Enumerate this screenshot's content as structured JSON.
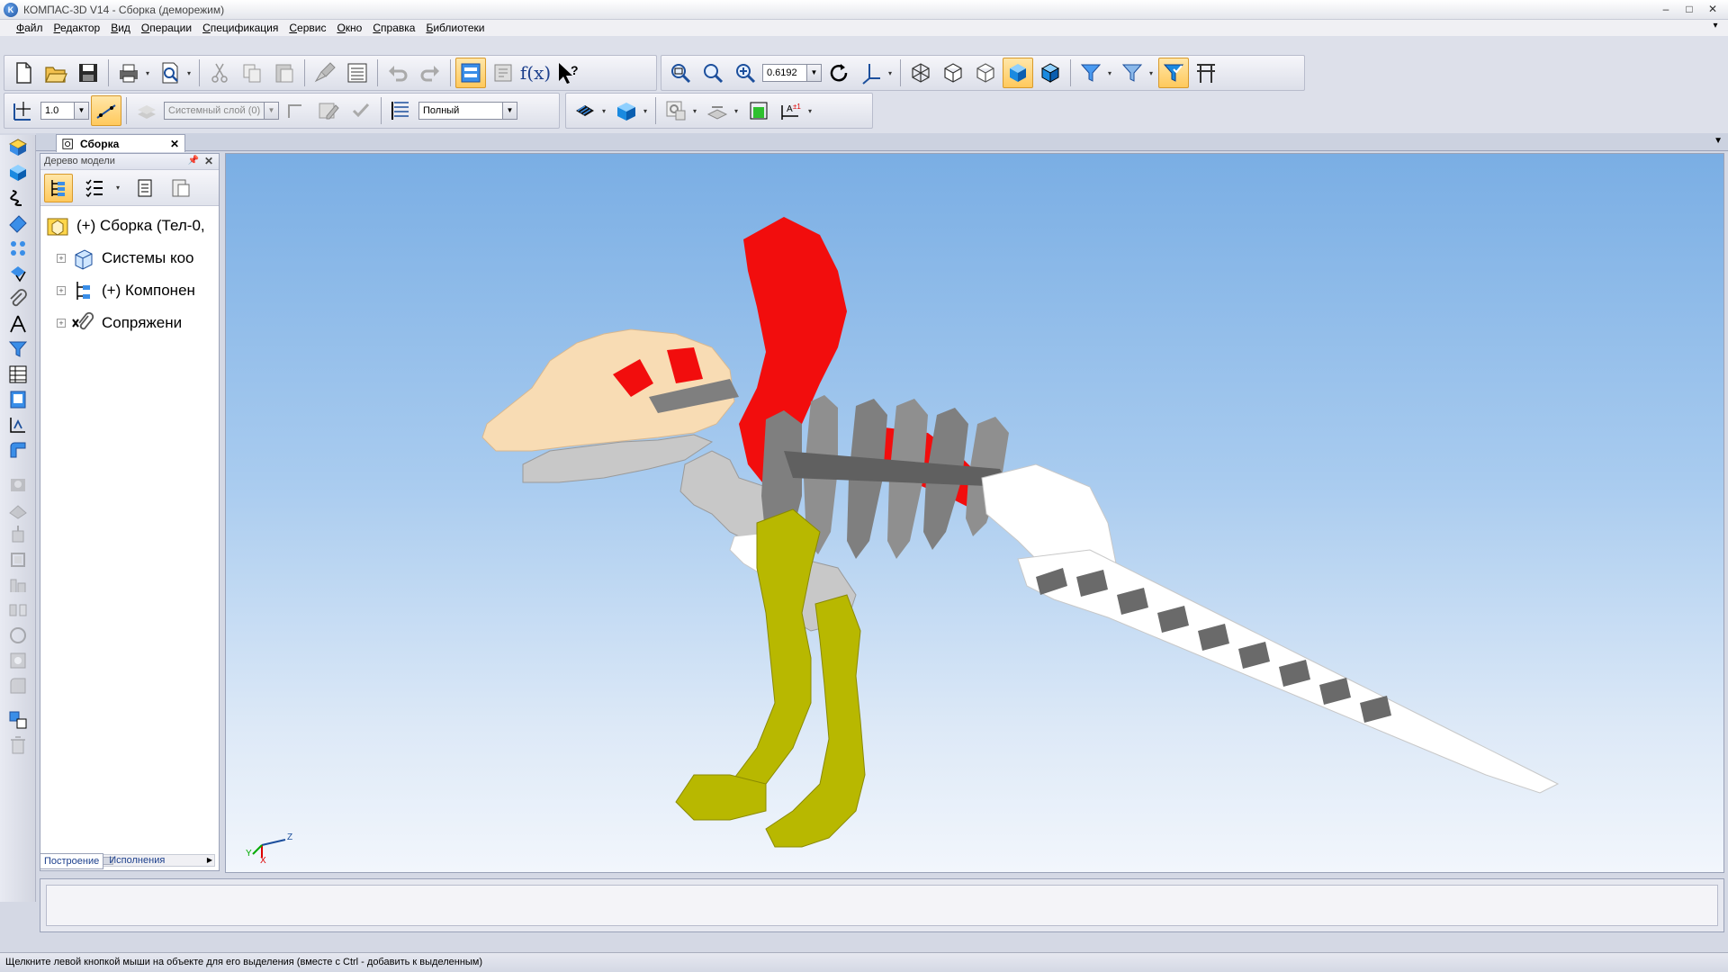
{
  "window": {
    "title": "КОМПАС-3D V14 - Сборка (деморежим)",
    "app_icon": "kompas-logo",
    "controls": [
      "–",
      "□",
      "✕"
    ]
  },
  "menu": [
    "Файл",
    "Редактор",
    "Вид",
    "Операции",
    "Спецификация",
    "Сервис",
    "Окно",
    "Справка",
    "Библиотеки"
  ],
  "toolbar": {
    "zoom_value": "0.6192",
    "step_value": "1.0",
    "layer_value": "Системный слой (0)",
    "mode_value": "Полный",
    "fx_label": "f(x)"
  },
  "document": {
    "tab_label": "Сборка",
    "tab_close": "✕"
  },
  "tree_panel": {
    "title": "Дерево модели",
    "items": [
      {
        "label": "(+) Сборка (Тел-0,",
        "icon": "assembly-icon"
      },
      {
        "label": "Системы коо",
        "icon": "coordinate-systems-icon"
      },
      {
        "label": "(+) Компонен",
        "icon": "components-icon"
      },
      {
        "label": "Сопряжени",
        "icon": "mates-icon"
      }
    ],
    "tabs": [
      "Построение",
      "Исполнения"
    ]
  },
  "triad": {
    "x": "X",
    "y": "Y",
    "z": "Z"
  },
  "status": {
    "text": "Щелкните левой кнопкой мыши на объекте для его выделения (вместе с Ctrl - добавить к выделенным)"
  },
  "colors": {
    "skull": "#f8dcb4",
    "neck_red": "#f20d0d",
    "ribs_gray": "#7f7f7f",
    "legs_olive": "#b8b800",
    "tail_white": "#ffffff",
    "arms_light": "#c8c8c8"
  }
}
